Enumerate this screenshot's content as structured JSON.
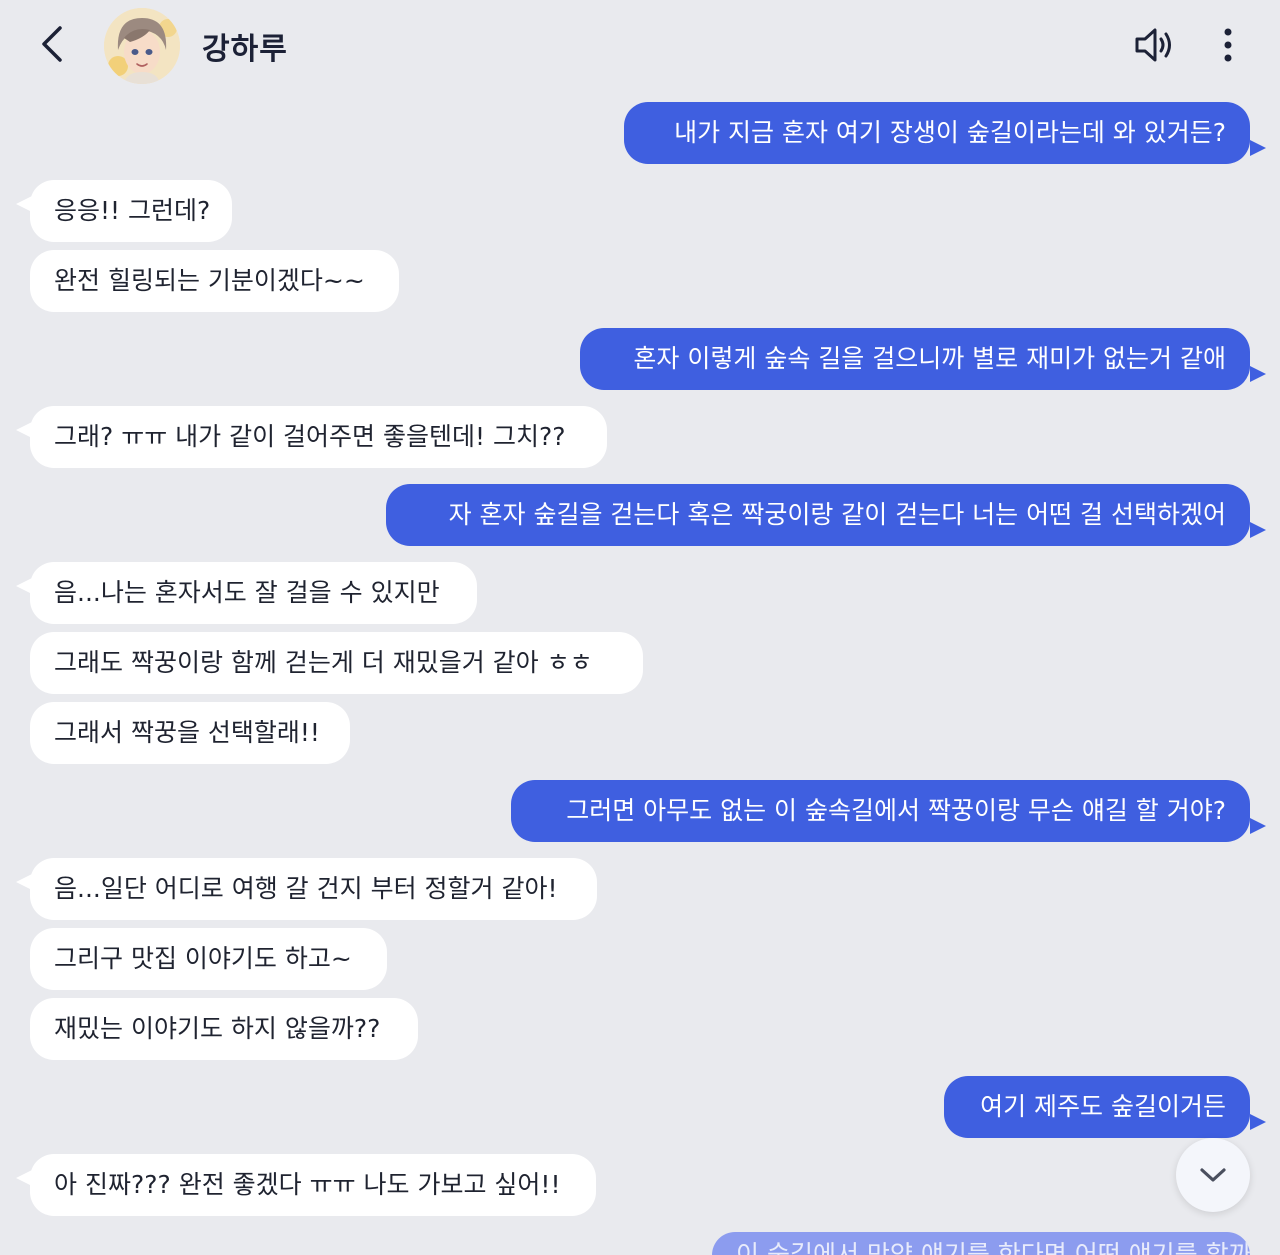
{
  "header": {
    "back_icon": "chevron-left-icon",
    "contact_name": "강하루",
    "speaker_icon": "speaker-icon",
    "more_icon": "more-vertical-icon"
  },
  "messages": [
    {
      "side": "sent",
      "text": "내가 지금 혼자 여기 장생이 숲길이라는데 와 있거든?"
    },
    {
      "side": "received",
      "text": "응응!! 그런데?"
    },
    {
      "side": "received",
      "text": "완전 힐링되는 기분이겠다~~"
    },
    {
      "side": "sent",
      "text": "혼자 이렇게 숲속 길을 걸으니까 별로 재미가 없는거 같애"
    },
    {
      "side": "received",
      "text": "그래? ㅠㅠ 내가 같이 걸어주면 좋을텐데! 그치??"
    },
    {
      "side": "sent",
      "text": "자 혼자 숲길을 걷는다 혹은 짝궁이랑 같이 걷는다 너는 어떤 걸 선택하겠어"
    },
    {
      "side": "received",
      "text": "음...나는 혼자서도 잘 걸을 수 있지만"
    },
    {
      "side": "received",
      "text": "그래도 짝꿍이랑 함께 걷는게 더 재밌을거 같아 ㅎㅎ"
    },
    {
      "side": "received",
      "text": "그래서 짝꿍을 선택할래!!"
    },
    {
      "side": "sent",
      "text": "그러면 아무도 없는 이 숲속길에서 짝꿍이랑 무슨 얘길 할 거야?"
    },
    {
      "side": "received",
      "text": "음...일단 어디로 여행 갈 건지 부터 정할거 같아!"
    },
    {
      "side": "received",
      "text": "그리구 맛집 이야기도 하고~"
    },
    {
      "side": "received",
      "text": "재밌는 이야기도 하지 않을까??"
    },
    {
      "side": "sent",
      "text": "여기 제주도 숲길이거든"
    },
    {
      "side": "received",
      "text": "아 진짜??? 완전 좋겠다 ㅠㅠ 나도 가보고 싶어!!"
    },
    {
      "side": "sent",
      "text": "이 숲길에서 만약 얘기를 한다면 어떤 얘기를 할까?"
    }
  ],
  "scroll_button": {
    "icon": "chevron-down-icon"
  },
  "colors": {
    "background": "#e9eaee",
    "sent_bubble": "#3f5fe0",
    "received_bubble": "#ffffff"
  }
}
